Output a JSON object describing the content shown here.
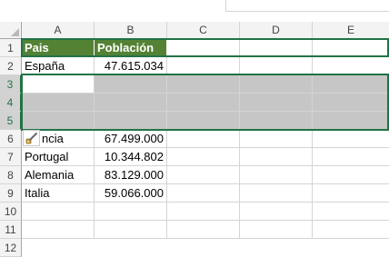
{
  "columns": [
    "A",
    "B",
    "C",
    "D",
    "E"
  ],
  "rows": [
    "1",
    "2",
    "3",
    "4",
    "5",
    "6",
    "7",
    "8",
    "9",
    "10",
    "11",
    "12"
  ],
  "table": {
    "header": {
      "country": "Pais",
      "population": "Población"
    },
    "row2": {
      "country": "España",
      "population": "47.615.034"
    },
    "row6": {
      "country": "ncia",
      "population": "67.499.000"
    },
    "row7": {
      "country": "Portugal",
      "population": "10.344.802"
    },
    "row8": {
      "country": "Alemania",
      "population": "83.129.000"
    },
    "row9": {
      "country": "Italia",
      "population": "59.066.000"
    }
  },
  "colors": {
    "header_fill": "#548235",
    "selection_border": "#217346",
    "selection_fill": "#c6c6c6"
  },
  "icons": {
    "paste_options": "paste-brush-icon"
  }
}
